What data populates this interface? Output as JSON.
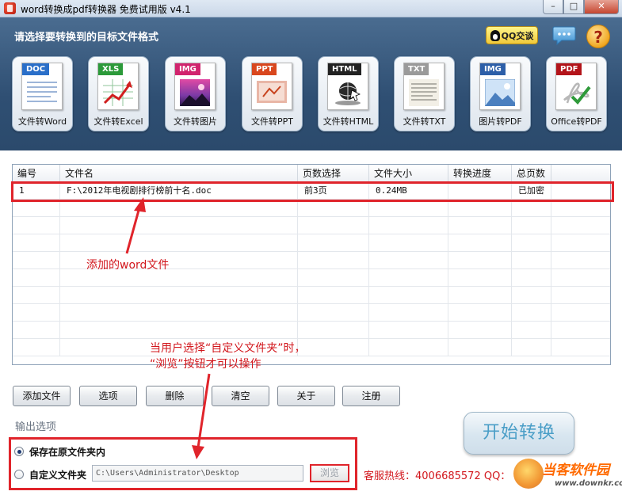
{
  "window": {
    "title": "word转换成pdf转换器 免费试用版 v4.1",
    "minimize": "–",
    "maximize": "□",
    "close": "✕"
  },
  "header": {
    "title": "请选择要转换到的目标文件格式",
    "qq_label": "QQ交谈",
    "chat_icon": "chat-bubble-icon",
    "help_icon": "?"
  },
  "tiles": [
    {
      "tag": "DOC",
      "label": "文件转Word",
      "color": "#2a6fc9"
    },
    {
      "tag": "XLS",
      "label": "文件转Excel",
      "color": "#2c9a3a"
    },
    {
      "tag": "IMG",
      "label": "文件转图片",
      "color": "#d1246e"
    },
    {
      "tag": "PPT",
      "label": "文件转PPT",
      "color": "#d9471e"
    },
    {
      "tag": "HTML",
      "label": "文件转HTML",
      "color": "#222222"
    },
    {
      "tag": "TXT",
      "label": "文件转TXT",
      "color": "#9a9a9a"
    },
    {
      "tag": "IMG",
      "label": "图片转PDF",
      "color": "#2d5fa8"
    },
    {
      "tag": "PDF",
      "label": "Office转PDF",
      "color": "#b3141a"
    }
  ],
  "filelist": {
    "columns": [
      "编号",
      "文件名",
      "页数选择",
      "文件大小",
      "转换进度",
      "总页数"
    ],
    "rows": [
      {
        "no": "1",
        "name": "F:\\2012年电视剧排行榜前十名.doc",
        "pages": "前3页",
        "size": "0.24MB",
        "progress": "",
        "total": "已加密"
      }
    ]
  },
  "annotations": {
    "added": "添加的word文件",
    "browse_hint_line1": "当用户选择“自定义文件夹”时，",
    "browse_hint_line2": "“浏览”按钮才可以操作"
  },
  "buttons": {
    "add": "添加文件",
    "options": "选项",
    "delete": "删除",
    "clear": "清空",
    "about": "关于",
    "register": "注册",
    "start": "开始转换"
  },
  "output": {
    "label": "输出选项",
    "keep_in_place": "保存在原文件夹内",
    "custom_folder": "自定义文件夹",
    "path": "C:\\Users\\Administrator\\Desktop",
    "browse": "浏览",
    "selected": "keep_in_place"
  },
  "footer": {
    "hotline": "客服热线：4006685572 QQ：",
    "watermark": "当客软件园",
    "watermark_url": "www.downkr.com"
  },
  "colors": {
    "annotation_red": "#e0242b",
    "header_blue": "#2f4f73"
  }
}
